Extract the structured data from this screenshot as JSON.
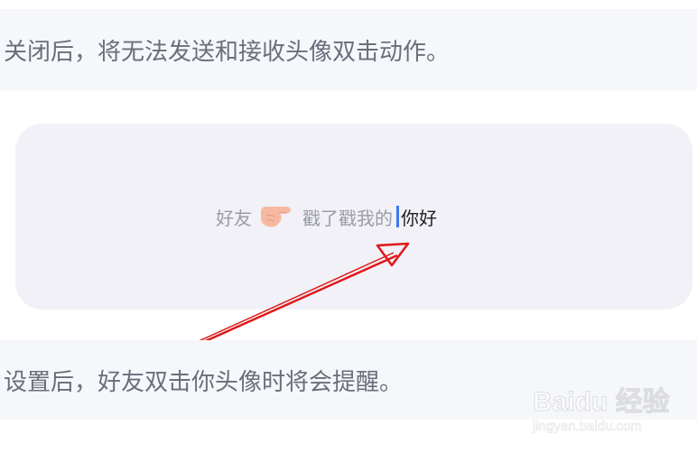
{
  "settings": {
    "off_description": "关闭后，将无法发送和接收头像双击动作。",
    "on_description": "设置后，好友双击你头像时将会提醒。"
  },
  "preview": {
    "friend_label": "好友",
    "hand_icon": "pointing-hand-icon",
    "action_text": "戳了戳我的",
    "suffix_text": "你好",
    "cursor_color": "#3b78f0",
    "arrow_color": "#e01818"
  },
  "watermark": {
    "brand": "Baidu 经验",
    "url": "jingyan.baidu.com"
  }
}
